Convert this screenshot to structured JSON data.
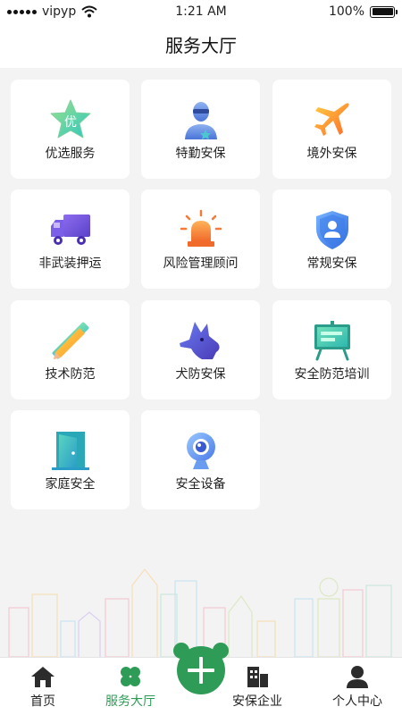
{
  "status_bar": {
    "carrier": "vipyp",
    "time": "1:21 AM",
    "battery": "100%"
  },
  "header": {
    "title": "服务大厅"
  },
  "services": [
    {
      "label": "优选服务",
      "icon": "star-badge-icon",
      "badge": "优"
    },
    {
      "label": "特勤安保",
      "icon": "guard-icon"
    },
    {
      "label": "境外安保",
      "icon": "airplane-icon"
    },
    {
      "label": "非武装押运",
      "icon": "truck-icon"
    },
    {
      "label": "风险管理顾问",
      "icon": "alarm-light-icon"
    },
    {
      "label": "常规安保",
      "icon": "shield-user-icon"
    },
    {
      "label": "技术防范",
      "icon": "tools-icon"
    },
    {
      "label": "犬防安保",
      "icon": "dog-icon"
    },
    {
      "label": "安全防范培训",
      "icon": "presentation-board-icon"
    },
    {
      "label": "家庭安全",
      "icon": "door-icon"
    },
    {
      "label": "安全设备",
      "icon": "webcam-icon"
    }
  ],
  "tabbar": {
    "items": [
      {
        "label": "首页",
        "icon": "home-icon"
      },
      {
        "label": "服务大厅",
        "icon": "clover-icon",
        "active": true
      },
      {
        "label": "安保企业",
        "icon": "building-icon"
      },
      {
        "label": "个人中心",
        "icon": "user-icon"
      }
    ],
    "center_button": "plus-icon"
  },
  "colors": {
    "accent": "#2e9c57",
    "background": "#f3f3f3"
  }
}
